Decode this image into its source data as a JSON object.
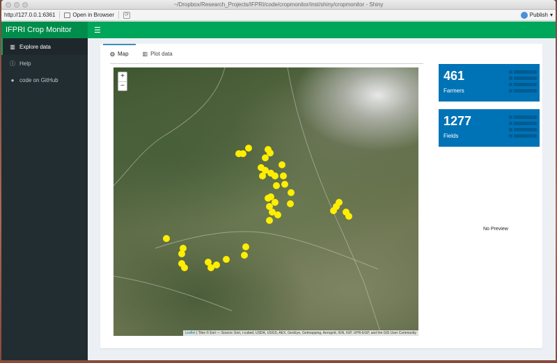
{
  "browser": {
    "window_title": "~/Dropbox/Research_Projects/IFPRI/code/cropmonitor/inst/shiny/cropmonitor - Shiny",
    "address": "http://127.0.0.1:6361",
    "open_in_browser": "Open in Browser",
    "publish": "Publish"
  },
  "header": {
    "title": "IFPRI Crop Monitor",
    "menu_icon": "hamburger-icon"
  },
  "sidebar": {
    "items": [
      {
        "label": "Explore data",
        "icon": "bar-chart-icon"
      },
      {
        "label": "Help",
        "icon": "info-icon"
      },
      {
        "label": "code on GitHub",
        "icon": "github-icon"
      }
    ]
  },
  "tabs": [
    {
      "label": "Map",
      "icon": "globe-icon"
    },
    {
      "label": "Plot data",
      "icon": "bar-chart-icon"
    }
  ],
  "map": {
    "zoom_in": "+",
    "zoom_out": "−",
    "attribution_link": "Leaflet",
    "attribution_text": " | Tiles © Esri — Source: Esri, i-cubed, USDA, USGS, AEX, GeoEye, Getmapping, Aerogrid, IGN, IGP, UPR-EGP, and the GIS User Community",
    "marker_color": "#ffee00"
  },
  "value_boxes": [
    {
      "value": "461",
      "label": "Farmers",
      "color": "#0073b7"
    },
    {
      "value": "1277",
      "label": "Fields",
      "color": "#0073b7"
    }
  ],
  "preview": {
    "text": "No Preview"
  },
  "colors": {
    "header": "#00a65a",
    "sidebar": "#222d32",
    "accent": "#3c8dbc"
  }
}
